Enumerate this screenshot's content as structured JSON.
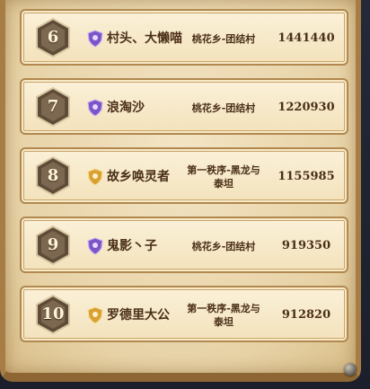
{
  "leaderboard": {
    "rows": [
      {
        "rank": "6",
        "name": "村头、大懒喵",
        "guild": "桃花乡-团结村",
        "score": "1441440",
        "avatar_icon": "purple-crest-icon"
      },
      {
        "rank": "7",
        "name": "浪淘沙",
        "guild": "桃花乡-团结村",
        "score": "1220930",
        "avatar_icon": "purple-crest-icon"
      },
      {
        "rank": "8",
        "name": "故乡唤灵者",
        "guild": "第一秩序-黑龙与泰坦",
        "score": "1155985",
        "avatar_icon": "gold-crest-icon"
      },
      {
        "rank": "9",
        "name": "鬼影丶子",
        "guild": "桃花乡-团结村",
        "score": "919350",
        "avatar_icon": "purple-crest-icon"
      },
      {
        "rank": "10",
        "name": "罗德里大公",
        "guild": "第一秩序-黑龙与泰坦",
        "score": "912820",
        "avatar_icon": "gold-crest-icon"
      }
    ]
  },
  "colors": {
    "parchment": "#f3e4c4",
    "row_border": "#b08850",
    "text": "#4a2f18",
    "badge_fill": "#7c6850",
    "purple_icon": "#7c55c8",
    "gold_icon": "#d9a033"
  }
}
